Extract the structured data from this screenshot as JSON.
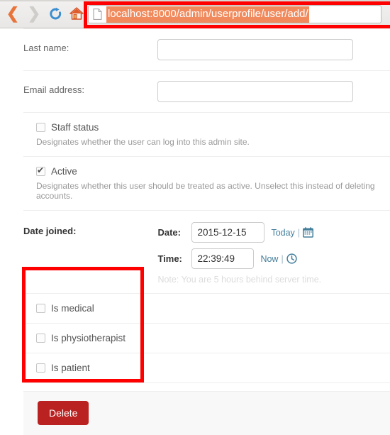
{
  "browser": {
    "back_icon": "back-chevron-icon",
    "forward_icon": "forward-chevron-icon",
    "reload_icon": "reload-icon",
    "home_icon": "home-icon",
    "page_icon": "page-document-icon",
    "url": "localhost:8000/admin/userprofile/user/add/",
    "url_selected": true,
    "selection_color": "#f08a5d"
  },
  "form": {
    "fields": [
      {
        "label": "Last name:",
        "value": "",
        "placeholder": ""
      },
      {
        "label": "Email address:",
        "value": "",
        "placeholder": ""
      }
    ],
    "staff": {
      "label": "Staff status",
      "checked": false,
      "help": "Designates whether the user can log into this admin site."
    },
    "active": {
      "label": "Active",
      "checked": true,
      "help": "Designates whether this user should be treated as active. Unselect this instead of deleting accounts."
    },
    "date_joined": {
      "label": "Date joined:",
      "date_label": "Date:",
      "date_value": "2015-12-15",
      "today_link": "Today",
      "separator": "|",
      "calendar_icon": "calendar-icon",
      "time_label": "Time:",
      "time_value": "22:39:49",
      "now_link": "Now",
      "clock_icon": "clock-icon",
      "note": "Note: You are 5 hours behind server time."
    },
    "custom_flags": [
      {
        "label": "Is medical",
        "checked": false
      },
      {
        "label": "Is physiotherapist",
        "checked": false
      },
      {
        "label": "Is patient",
        "checked": false
      }
    ]
  },
  "footer": {
    "delete_label": "Delete",
    "delete_color": "#ba2121"
  },
  "annotations": {
    "url_box_color": "#ff0000",
    "checkbox_box_color": "#ff0000"
  }
}
